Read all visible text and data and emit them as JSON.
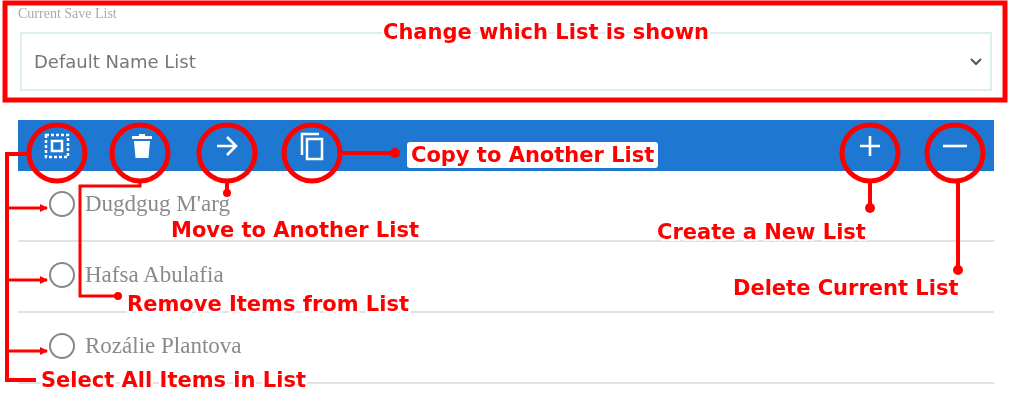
{
  "save_list": {
    "label": "Current Save List",
    "value": "Default Name List"
  },
  "toolbar": {
    "left": [
      {
        "kind": "select-all"
      },
      {
        "kind": "delete"
      },
      {
        "kind": "move"
      },
      {
        "kind": "copy"
      }
    ],
    "right": [
      {
        "kind": "add"
      },
      {
        "kind": "remove"
      }
    ]
  },
  "items": [
    {
      "name": "Dugdgug M'arg",
      "selected": false
    },
    {
      "name": "Hafsa Abulafia",
      "selected": false
    },
    {
      "name": "Rozálie Plantova",
      "selected": false
    }
  ],
  "annotations": [
    {
      "text": "Change which List is shown"
    },
    {
      "text": "Copy to Another List"
    },
    {
      "text": "Move to Another List"
    },
    {
      "text": "Create a New List"
    },
    {
      "text": "Remove Items from List"
    },
    {
      "text": "Delete Current List"
    },
    {
      "text": "Select All Items in List"
    }
  ]
}
